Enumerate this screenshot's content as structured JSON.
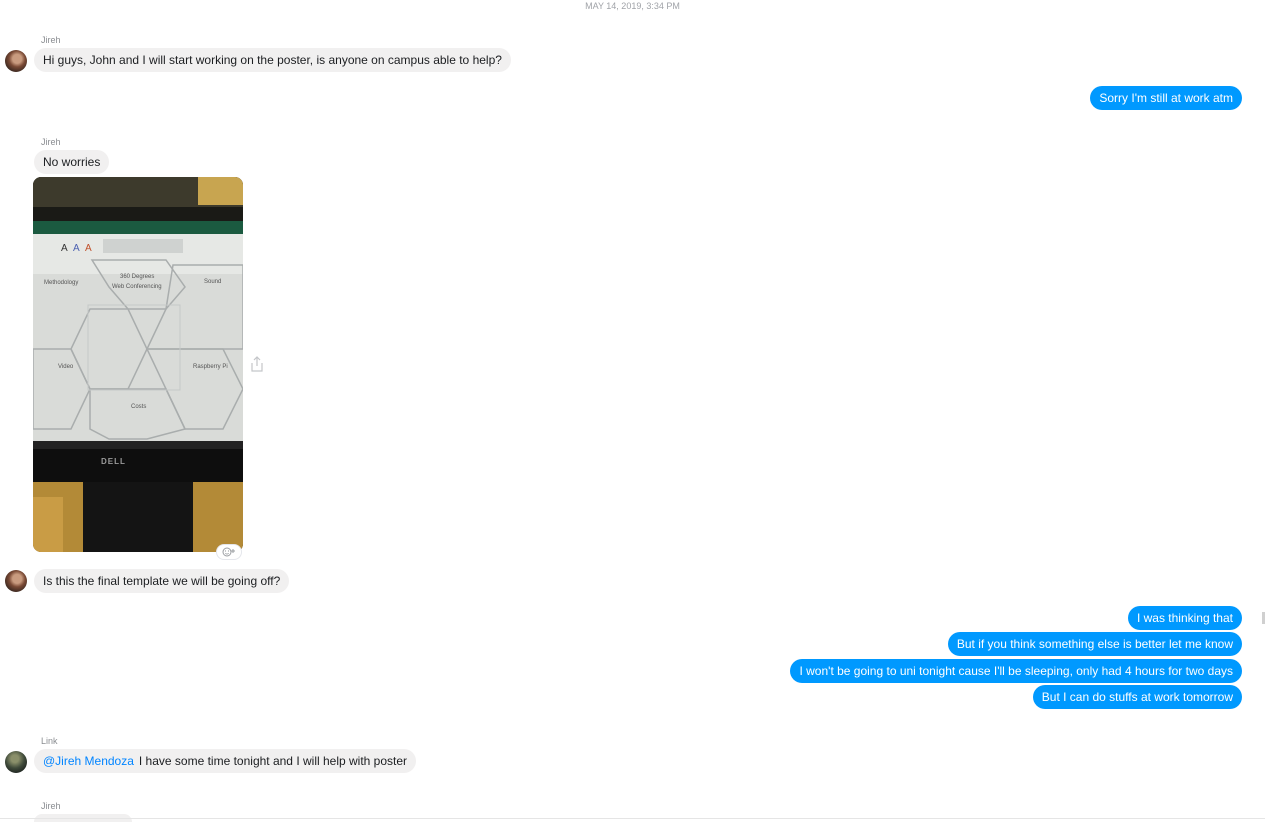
{
  "timestamp": "MAY 14, 2019, 3:34 PM",
  "messages": [
    {
      "sender": "Jireh",
      "text": "Hi guys, John and I will start working on the poster, is anyone on campus able to help?"
    },
    {
      "text": "Sorry I'm still at work atm"
    },
    {
      "sender": "Jireh",
      "text": "No worries"
    },
    {
      "text": "Is this the final template we will be going off?"
    },
    {
      "text": "I was thinking that"
    },
    {
      "text": "But if you think something else is better let me know"
    },
    {
      "text": "I won't be going to uni tonight cause I'll be sleeping, only had 4 hours for two days"
    },
    {
      "text": "But I can do stuffs at work tomorrow"
    },
    {
      "sender": "Link",
      "mention": "@Jireh Mendoza",
      "text": "I have some time tonight and I will help with poster"
    },
    {
      "sender": "Jireh"
    }
  ],
  "photo": {
    "cells": [
      "Methodology",
      "360 Degrees",
      "Web Conferencing",
      "Sound",
      "Video",
      "Raspberry Pi",
      "Costs"
    ],
    "monitor_brand": "DELL"
  },
  "icons": {
    "share": "share-icon",
    "react": "add-reaction-icon"
  },
  "colors": {
    "outgoing": "#0099ff",
    "incoming": "#f1f0f0",
    "mention": "#0084ff"
  }
}
